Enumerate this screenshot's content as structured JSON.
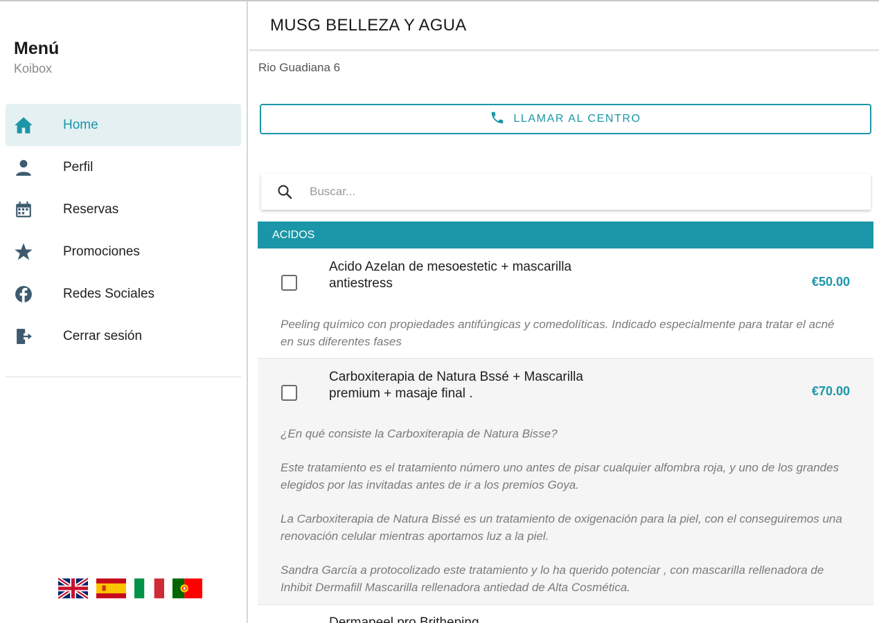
{
  "sidebar": {
    "title": "Menú",
    "subtitle": "Koibox",
    "items": [
      {
        "label": "Home",
        "icon": "home-icon"
      },
      {
        "label": "Perfil",
        "icon": "person-icon"
      },
      {
        "label": "Reservas",
        "icon": "calendar-icon"
      },
      {
        "label": "Promociones",
        "icon": "star-icon"
      },
      {
        "label": "Redes Sociales",
        "icon": "facebook-icon"
      },
      {
        "label": "Cerrar sesión",
        "icon": "logout-icon"
      }
    ],
    "flags": [
      "uk-flag",
      "spain-flag",
      "italy-flag",
      "portugal-flag"
    ]
  },
  "header": {
    "title": "MUSG BELLEZA Y AGUA"
  },
  "center": {
    "address": "Rio Guadiana 6",
    "call_label": "LLAMAR AL CENTRO"
  },
  "search": {
    "placeholder": "Buscar..."
  },
  "section": {
    "label": "ACIDOS"
  },
  "services": [
    {
      "name": "Acido Azelan de mesoestetic + mascarilla antiestress",
      "price": "€50.00",
      "description": [
        "Peeling químico con propiedades antifúngicas y comedolíticas. Indicado especialmente para tratar el acné en sus diferentes fases"
      ]
    },
    {
      "name": "Carboxiterapia de Natura Bssé + Mascarilla premium + masaje final .",
      "price": "€70.00",
      "description": [
        "¿En qué consiste la Carboxiterapia de Natura Bisse?",
        "Este tratamiento es el tratamiento número uno antes de pisar cualquier alfombra roja, y uno de los grandes elegidos por las invitadas antes de ir a los premios Goya.",
        "La Carboxiterapia de Natura Bissé es un tratamiento de oxigenación para la piel, con el conseguiremos una renovación celular mientras aportamos luz a la piel.",
        "Sandra García a protocolizado este tratamiento y lo ha querido potenciar , con mascarilla rellenadora de Inhibit Dermafill Mascarilla rellenadora antiedad de Alta Cosmética."
      ]
    },
    {
      "name": "Dermapeel pro Britheping"
    }
  ],
  "colors": {
    "accent": "#1b96a8",
    "active_bg": "#e4f0f2",
    "icon": "#3d5a6e"
  }
}
